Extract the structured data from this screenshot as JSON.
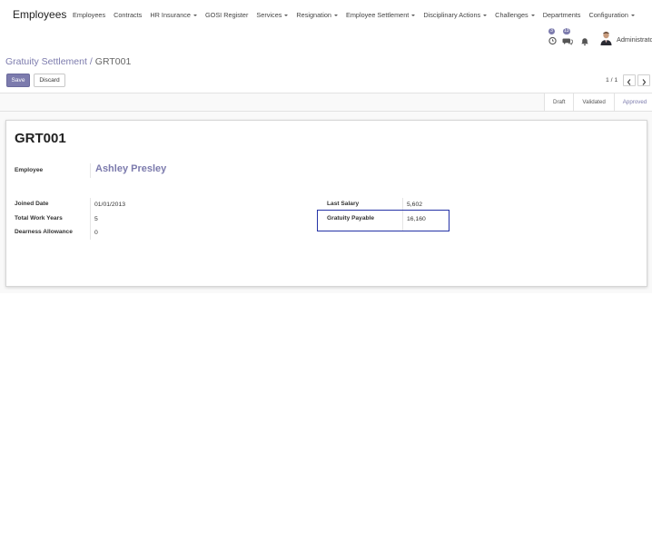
{
  "navbar": {
    "brand": "Employees",
    "menu": [
      {
        "label": "Employees",
        "dropdown": false
      },
      {
        "label": "Contracts",
        "dropdown": false
      },
      {
        "label": "HR Insurance",
        "dropdown": true
      },
      {
        "label": "GOSI Register",
        "dropdown": false
      },
      {
        "label": "Services",
        "dropdown": true
      },
      {
        "label": "Resignation",
        "dropdown": true
      },
      {
        "label": "Employee Settlement",
        "dropdown": true
      },
      {
        "label": "Disciplinary Actions",
        "dropdown": true
      },
      {
        "label": "Challenges",
        "dropdown": true
      },
      {
        "label": "Departments",
        "dropdown": false
      },
      {
        "label": "Configuration",
        "dropdown": true
      }
    ],
    "systray": {
      "activity_count": "3",
      "messages_count": "13",
      "user_name": "Administrator",
      "icons": [
        "clock-icon",
        "chat-icon",
        "bell-icon",
        "avatar"
      ]
    }
  },
  "control_panel": {
    "breadcrumb_parent": "Gratuity Settlement",
    "breadcrumb_separator": "/",
    "breadcrumb_current": "GRT001",
    "save_label": "Save",
    "discard_label": "Discard",
    "pager_value": "1 / 1"
  },
  "statusbar": {
    "states": [
      "Draft",
      "Validated",
      "Approved"
    ],
    "active_state": "Approved"
  },
  "form": {
    "title": "GRT001",
    "employee_label": "Employee",
    "employee_value": "Ashley Presley",
    "joined_date_label": "Joined Date",
    "joined_date_value": "01/01/2013",
    "total_work_years_label": "Total Work Years",
    "total_work_years_value": "5",
    "dearness_allowance_label": "Dearness Allowance",
    "dearness_allowance_value": "0",
    "last_salary_label": "Last Salary",
    "last_salary_value": "5,602",
    "gratuity_payable_label": "Gratuity Payable",
    "gratuity_payable_value": "16,160"
  },
  "colors": {
    "accent": "#7c7bad",
    "highlight_border": "#2432a6"
  }
}
